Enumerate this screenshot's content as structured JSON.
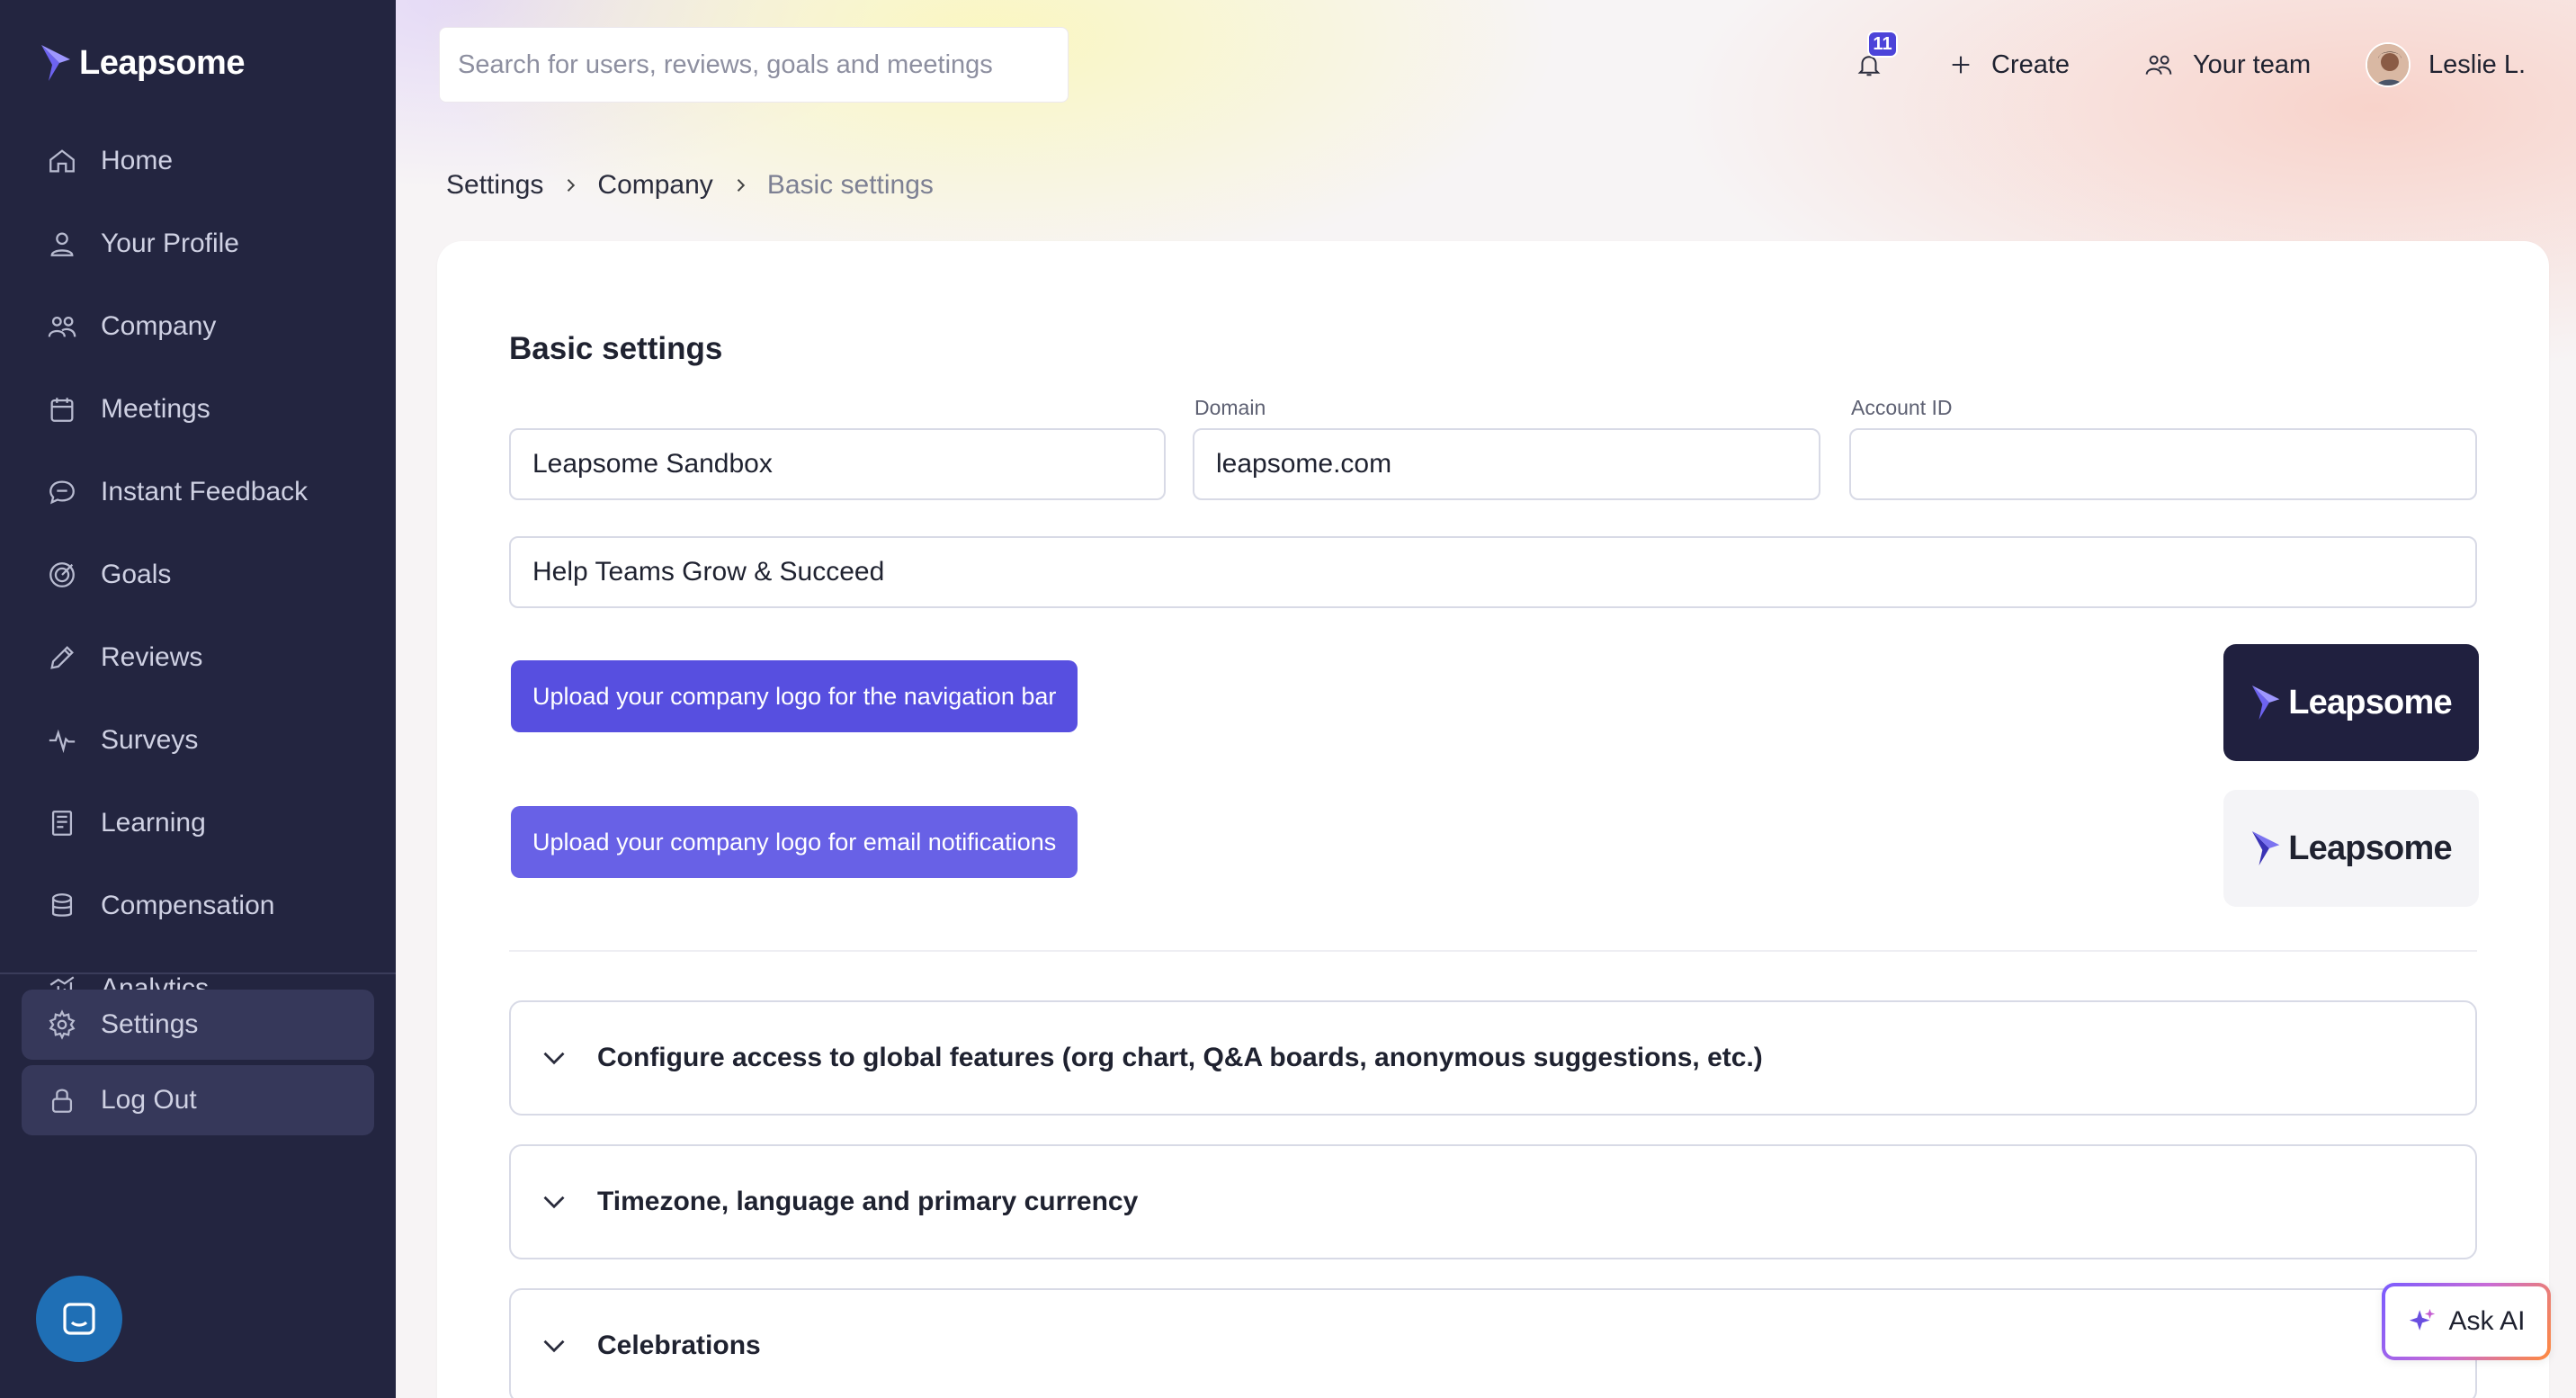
{
  "app": {
    "brand": "Leapsome",
    "accent_color": "#574fe0",
    "sidebar_color": "#232540"
  },
  "sidebar": {
    "items": [
      {
        "label": "Home",
        "icon": "home-icon"
      },
      {
        "label": "Your Profile",
        "icon": "user-icon"
      },
      {
        "label": "Company",
        "icon": "people-icon"
      },
      {
        "label": "Meetings",
        "icon": "calendar-icon"
      },
      {
        "label": "Instant Feedback",
        "icon": "chat-icon"
      },
      {
        "label": "Goals",
        "icon": "target-icon"
      },
      {
        "label": "Reviews",
        "icon": "pencil-icon"
      },
      {
        "label": "Surveys",
        "icon": "pulse-icon"
      },
      {
        "label": "Learning",
        "icon": "book-icon"
      },
      {
        "label": "Compensation",
        "icon": "coins-icon"
      },
      {
        "label": "Analytics",
        "icon": "bar-chart-icon"
      }
    ],
    "bottom_items": [
      {
        "label": "Settings",
        "icon": "gear-icon",
        "active": true
      },
      {
        "label": "Log Out",
        "icon": "lock-icon"
      }
    ]
  },
  "header": {
    "search_placeholder": "Search for users, reviews, goals and meetings",
    "notification_count": "11",
    "create_label": "Create",
    "team_label": "Your team",
    "user_name": "Leslie L."
  },
  "breadcrumb": {
    "items": [
      "Settings",
      "Company",
      "Basic settings"
    ]
  },
  "basic_settings": {
    "title": "Basic settings",
    "company_name_value": "Leapsome Sandbox",
    "domain_label": "Domain",
    "domain_value": "leapsome.com",
    "account_id_label": "Account ID",
    "account_id_value": "",
    "slogan_value": "Help Teams Grow & Succeed",
    "upload_nav_logo_label": "Upload your company logo for the navigation bar",
    "upload_email_logo_label": "Upload your company logo for email notifications",
    "nav_logo_text": "Leapsome",
    "email_logo_text": "Leapsome"
  },
  "accordions": [
    {
      "title": "Configure access to global features (org chart, Q&A boards, anonymous suggestions, etc.)"
    },
    {
      "title": "Timezone, language and primary currency"
    },
    {
      "title": "Celebrations"
    }
  ],
  "ask_ai_label": "Ask AI"
}
